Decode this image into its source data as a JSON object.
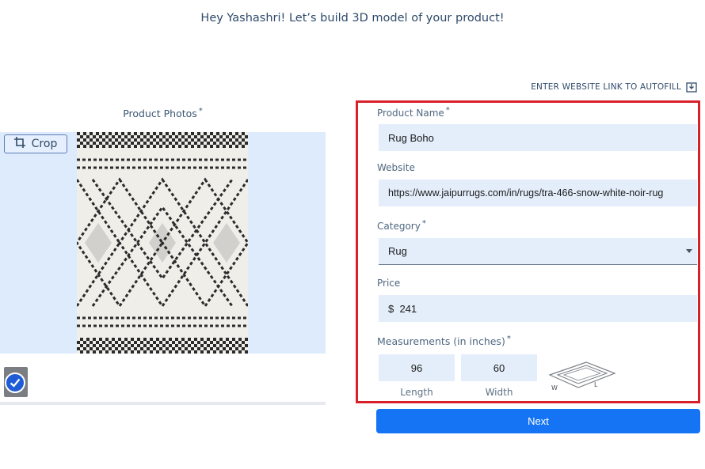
{
  "greeting": "Hey Yashashri! Let’s build 3D model of your product!",
  "autofill": {
    "label": "ENTER WEBSITE LINK TO AUTOFILL",
    "icon": "download-box-icon"
  },
  "photos": {
    "label": "Product Photos",
    "required_mark": "*",
    "crop_label": "Crop",
    "crop_icon": "crop-icon",
    "selected": true
  },
  "form": {
    "product_name": {
      "label": "Product Name",
      "required_mark": "*",
      "value": "Rug Boho"
    },
    "website": {
      "label": "Website",
      "value": "https://www.jaipurrugs.com/in/rugs/tra-466-snow-white-noir-rug"
    },
    "category": {
      "label": "Category",
      "required_mark": "*",
      "value": "Rug"
    },
    "price": {
      "label": "Price",
      "value": "$  241"
    },
    "measurements": {
      "label": "Measurements (in inches)",
      "required_mark": "*",
      "length": {
        "value": "96",
        "label": "Length"
      },
      "width": {
        "value": "60",
        "label": "Width"
      },
      "diagram": {
        "w_label": "W",
        "l_label": "L"
      }
    }
  },
  "next_label": "Next",
  "colors": {
    "accent": "#1574f4",
    "highlight_border": "#d9202a",
    "input_bg": "#e4eefb",
    "photo_bg": "#ddebfd"
  }
}
